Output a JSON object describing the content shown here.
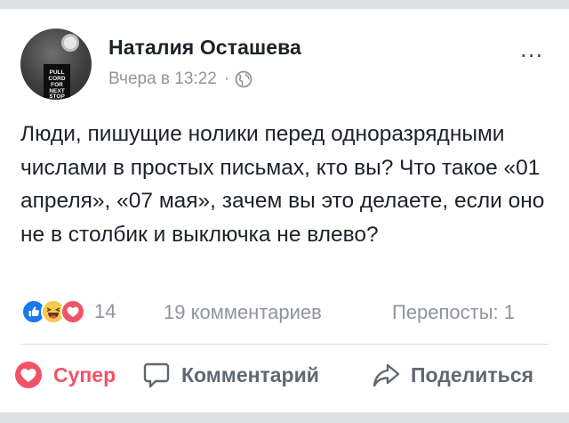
{
  "post": {
    "author": "Наталия Осташева",
    "time": "Вчера в 13:22",
    "dot": "·",
    "privacy_icon": "globe-icon",
    "menu_glyph": "...",
    "avatar_sign": "PULL CORD FOR NEXT STOP",
    "text": "Люди, пишущие нолики перед одноразрядными числами в простых письмах, кто вы? Что такое «01 апреля», «07 мая», зачем вы это делаете, если оно не в столбик и выключка не влево?"
  },
  "stats": {
    "reaction_icons": [
      "like-icon",
      "haha-icon",
      "love-icon"
    ],
    "reactions_count": "14",
    "comments": "19 комментариев",
    "shares": "Перепосты: 1"
  },
  "actions": {
    "love_label": "Супер",
    "comment_label": "Комментарий",
    "share_label": "Поделиться"
  },
  "colors": {
    "like": "#1877f2",
    "haha": "#f7c94b",
    "love": "#f25268",
    "muted": "#90949c",
    "text": "#1d2129"
  }
}
